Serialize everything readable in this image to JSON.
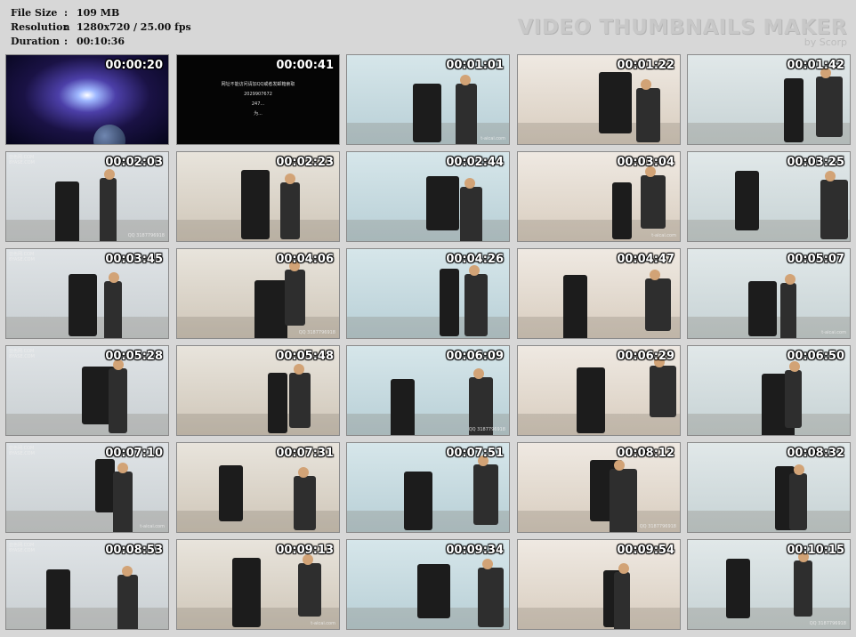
{
  "info": {
    "rows": [
      {
        "label": "File Size",
        "value": "109 MB"
      },
      {
        "label": "Resolution",
        "value": "1280x720 / 25.00 fps"
      },
      {
        "label": "Duration",
        "value": "00:10:36"
      }
    ],
    "separator": ":"
  },
  "watermark": {
    "title": "VIDEO THUMBNAILS MAKER",
    "by": "by Scorp"
  },
  "thumbnails": [
    {
      "time": "00:00:20",
      "kind": "space"
    },
    {
      "time": "00:00:41",
      "kind": "black"
    },
    {
      "time": "00:01:01",
      "kind": "room"
    },
    {
      "time": "00:01:22",
      "kind": "room"
    },
    {
      "time": "00:01:42",
      "kind": "room"
    },
    {
      "time": "00:02:03",
      "kind": "room"
    },
    {
      "time": "00:02:23",
      "kind": "room"
    },
    {
      "time": "00:02:44",
      "kind": "room"
    },
    {
      "time": "00:03:04",
      "kind": "room"
    },
    {
      "time": "00:03:25",
      "kind": "room"
    },
    {
      "time": "00:03:45",
      "kind": "room"
    },
    {
      "time": "00:04:06",
      "kind": "room"
    },
    {
      "time": "00:04:26",
      "kind": "room"
    },
    {
      "time": "00:04:47",
      "kind": "room"
    },
    {
      "time": "00:05:07",
      "kind": "room"
    },
    {
      "time": "00:05:28",
      "kind": "room"
    },
    {
      "time": "00:05:48",
      "kind": "room"
    },
    {
      "time": "00:06:09",
      "kind": "room"
    },
    {
      "time": "00:06:29",
      "kind": "room"
    },
    {
      "time": "00:06:50",
      "kind": "room"
    },
    {
      "time": "00:07:10",
      "kind": "room"
    },
    {
      "time": "00:07:31",
      "kind": "room"
    },
    {
      "time": "00:07:51",
      "kind": "room"
    },
    {
      "time": "00:08:12",
      "kind": "room"
    },
    {
      "time": "00:08:32",
      "kind": "room"
    },
    {
      "time": "00:08:53",
      "kind": "room"
    },
    {
      "time": "00:09:13",
      "kind": "room"
    },
    {
      "time": "00:09:34",
      "kind": "room"
    },
    {
      "time": "00:09:54",
      "kind": "room"
    },
    {
      "time": "00:10:15",
      "kind": "room"
    }
  ],
  "overlay": {
    "site": "8YASE.COM",
    "site_cn": "亚色网.COM",
    "corner_logo": "艾彩视频网",
    "corner_url": "t-aicai.com",
    "qq": "QQ 3187796918"
  },
  "black_frame_lines": [
    "网址不能访问请加QQ或者发邮箱索取",
    "2029907672",
    "247...",
    "为..."
  ],
  "colors": {
    "background": "#d7d7d7",
    "text": "#111111",
    "watermark": "#c8c8c8",
    "timestamp": "#ffffff"
  }
}
